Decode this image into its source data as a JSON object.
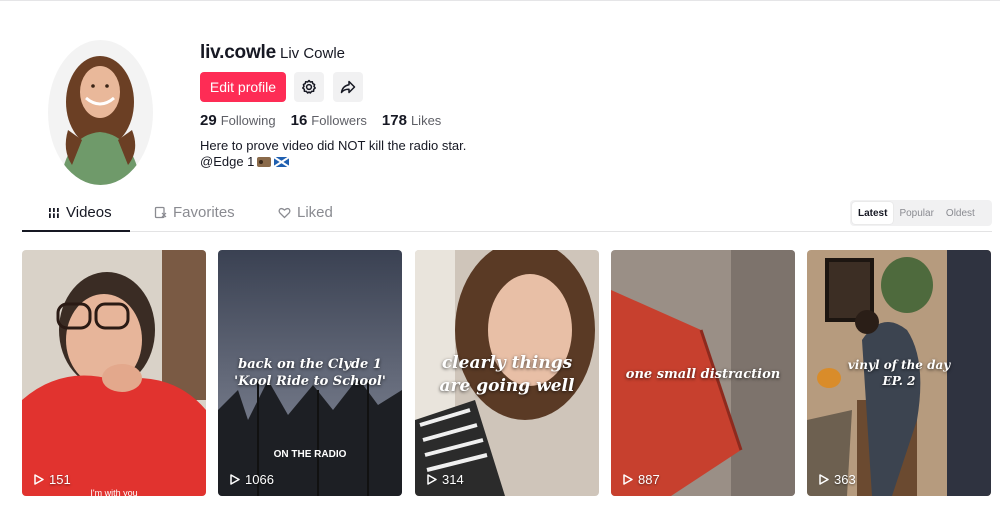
{
  "profile": {
    "username": "liv.cowle",
    "nickname": "Liv Cowle",
    "edit_label": "Edit profile",
    "stats": {
      "following_count": "29",
      "following_label": "Following",
      "followers_count": "16",
      "followers_label": "Followers",
      "likes_count": "178",
      "likes_label": "Likes"
    },
    "bio_line1": "Here to prove video did NOT kill the radio star.",
    "bio_line2": "@Edge 1"
  },
  "icons": {
    "settings": "gear-icon",
    "share": "share-icon",
    "videos": "grid-bars-icon",
    "favorites": "bookmark-icon",
    "liked": "heart-icon",
    "play": "play-icon"
  },
  "tabs": {
    "videos": "Videos",
    "favorites": "Favorites",
    "liked": "Liked"
  },
  "sort": {
    "latest": "Latest",
    "popular": "Popular",
    "oldest": "Oldest",
    "selected": "Latest"
  },
  "videos": [
    {
      "views": "151",
      "caption": "",
      "overlay": "I'm with you"
    },
    {
      "views": "1066",
      "caption_line1": "back on the Clyde 1",
      "caption_line2": "'Kool Ride to School'",
      "overlay": "ON THE RADIO"
    },
    {
      "views": "314",
      "caption_line1": "clearly things",
      "caption_line2": "are going well"
    },
    {
      "views": "887",
      "caption_line1": "one small distraction"
    },
    {
      "views": "363",
      "caption_line1": "vinyl of the day",
      "caption_line2": "EP. 2"
    }
  ],
  "colors": {
    "brand": "#fe2c55",
    "text": "#161823",
    "muted": "#8a8b91"
  }
}
